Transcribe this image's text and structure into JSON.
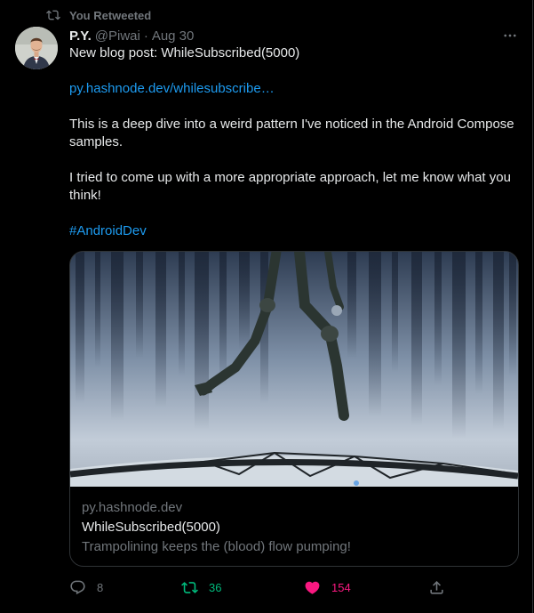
{
  "retweet_context": {
    "label": "You Retweeted"
  },
  "tweet": {
    "author_name": "P.Y.",
    "author_handle": "@Piwai",
    "separator": "·",
    "date": "Aug 30",
    "lines": {
      "line1": "New blog post: WhileSubscribed(5000)",
      "link": "py.hashnode.dev/whilesubscribe…",
      "para1": "This is a deep dive into a weird pattern I've noticed in the Android Compose samples.",
      "para2": "I tried to come up with a more appropriate approach, let me know what you think!",
      "hashtag": "#AndroidDev"
    }
  },
  "card": {
    "domain": "py.hashnode.dev",
    "title": "WhileSubscribed(5000)",
    "description": "Trampolining keeps the (blood) flow pumping!"
  },
  "actions": {
    "replies": "8",
    "retweets": "36",
    "likes": "154"
  },
  "colors": {
    "background": "#000000",
    "text": "#e7e9ea",
    "muted": "#71767b",
    "link": "#1d9bf0",
    "retweet_active": "#00ba7c",
    "like_active": "#f91880",
    "border": "#2f3336"
  },
  "icons": {
    "retweet_context": "retweet-icon",
    "more": "more-horizontal-icon",
    "reply": "reply-icon",
    "retweet": "retweet-icon",
    "like": "heart-filled-icon",
    "share": "share-icon"
  }
}
